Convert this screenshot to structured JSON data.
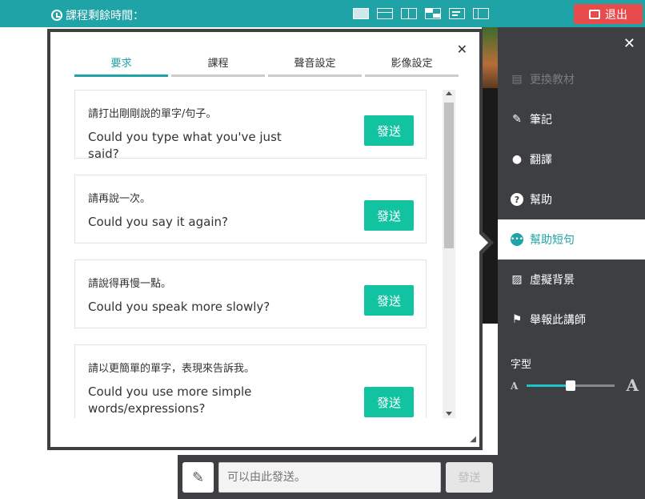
{
  "topbar": {
    "timer_label": "課程剩餘時間：",
    "layout_icons": [
      "layout-single-icon",
      "layout-top-bar-icon",
      "layout-split-icon",
      "layout-grid-icon",
      "layout-text-icon",
      "layout-side-icon"
    ],
    "exit_label": "退出"
  },
  "colors": {
    "accent": "#1fa3a6",
    "send": "#12c3a2",
    "exit": "#e84b4b",
    "panel": "#3d3f42"
  },
  "right_menu": {
    "items": [
      {
        "label": "更換教材",
        "icon": "book-icon",
        "state": "disabled"
      },
      {
        "label": "筆記",
        "icon": "edit-icon",
        "state": "normal"
      },
      {
        "label": "翻譯",
        "icon": "globe-icon",
        "state": "normal"
      },
      {
        "label": "幫助",
        "icon": "question-icon",
        "state": "normal"
      },
      {
        "label": "幫助短句",
        "icon": "chat-bubble-icon",
        "state": "active"
      },
      {
        "label": "虛擬背景",
        "icon": "image-icon",
        "state": "normal"
      },
      {
        "label": "舉報此講師",
        "icon": "flag-icon",
        "state": "normal"
      }
    ],
    "font_label": "字型",
    "font_small": "A",
    "font_large": "A",
    "font_size_level": 0.5
  },
  "modal": {
    "tabs": [
      {
        "label": "要求",
        "active": true
      },
      {
        "label": "課程",
        "active": false
      },
      {
        "label": "聲音設定",
        "active": false
      },
      {
        "label": "影像設定",
        "active": false
      }
    ],
    "send_label": "發送",
    "phrases": [
      {
        "zh": "請打出剛剛說的單字/句子。",
        "en": "Could you type what you've just said?"
      },
      {
        "zh": "請再說一次。",
        "en": "Could you say it again?"
      },
      {
        "zh": "請說得再慢一點。",
        "en": "Could you speak more slowly?"
      },
      {
        "zh": "請以更簡單的單字，表現來告訴我。",
        "en": "Could you use more simple words/expressions?"
      }
    ]
  },
  "chat": {
    "placeholder": "可以由此發送。",
    "send_label": "發送"
  }
}
